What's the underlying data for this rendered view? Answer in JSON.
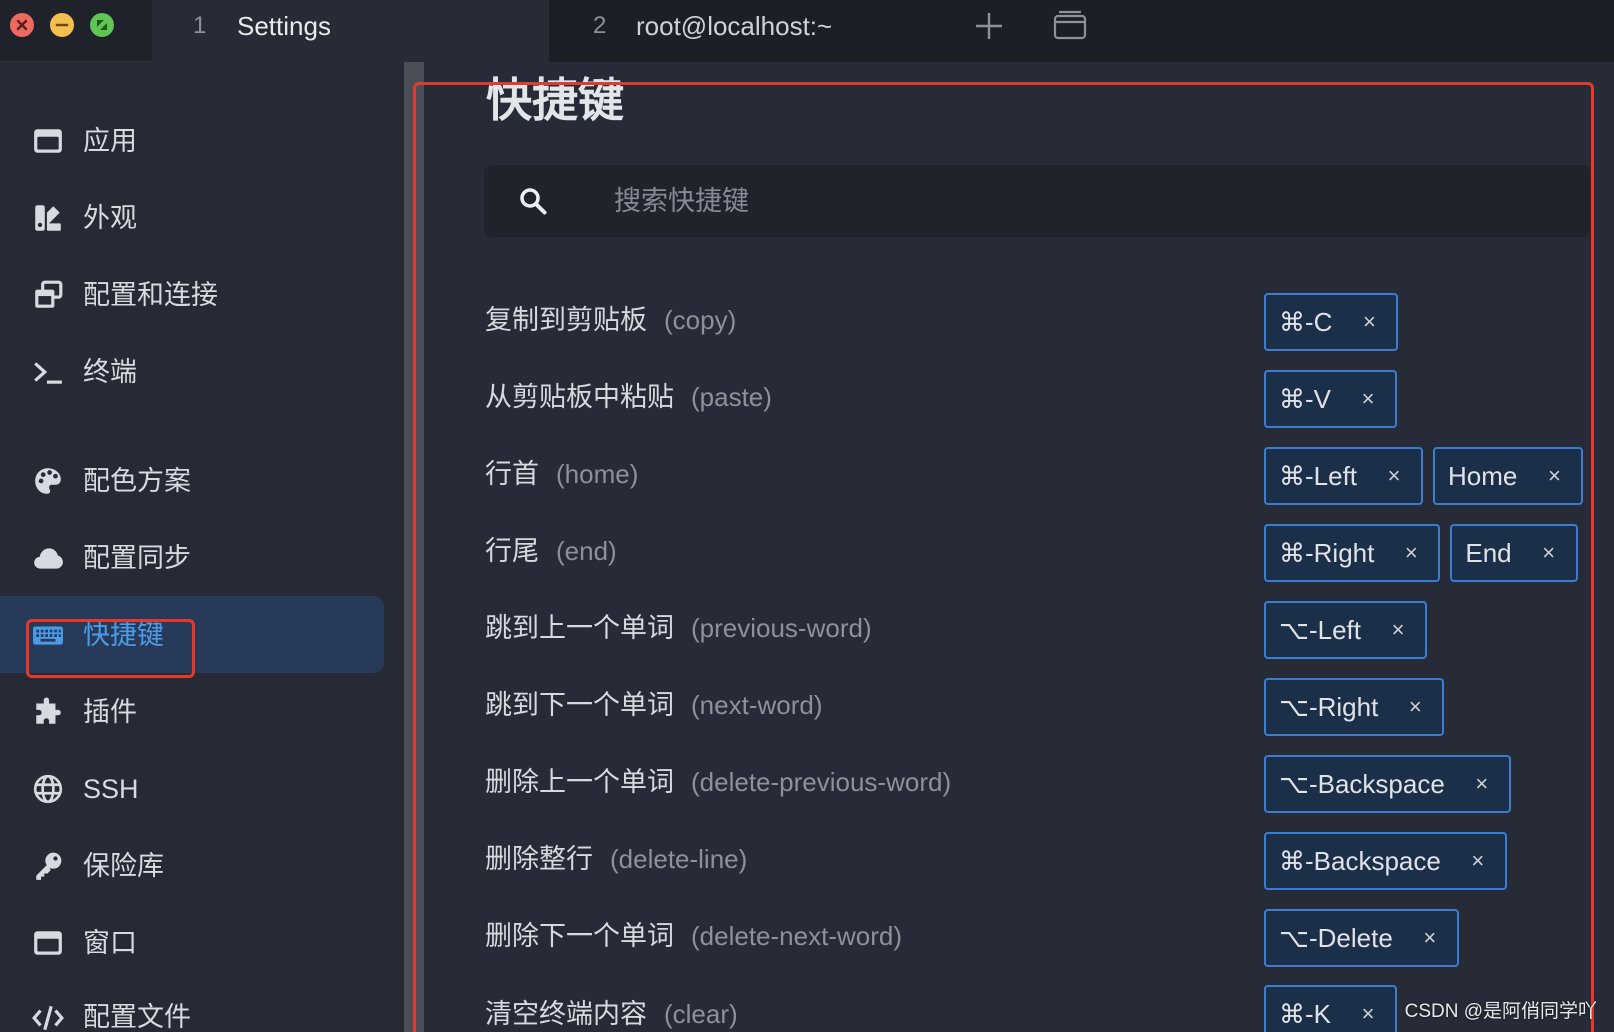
{
  "window": {
    "controls": [
      {
        "action": "close",
        "icon": "close-icon",
        "color": "#ed6a5e"
      },
      {
        "action": "minimize",
        "icon": "minimize-icon",
        "color": "#f5bf4f"
      },
      {
        "action": "maximize",
        "icon": "maximize-icon",
        "color": "#61c554"
      }
    ],
    "tabs": [
      {
        "number": "1",
        "title": "Settings",
        "active": true
      },
      {
        "number": "2",
        "title": "root@localhost:~",
        "active": false
      }
    ],
    "new_tab_icon": "plus-icon",
    "tabs_overview_icon": "window-stack-icon"
  },
  "sidebar": {
    "items": [
      {
        "label": "应用",
        "icon": "app-window-icon"
      },
      {
        "label": "外观",
        "icon": "swatchbook-icon"
      },
      {
        "label": "配置和连接",
        "icon": "window-restore-icon"
      },
      {
        "label": "终端",
        "icon": "terminal-icon"
      },
      {
        "label": "配色方案",
        "icon": "palette-icon"
      },
      {
        "label": "配置同步",
        "icon": "cloud-icon"
      },
      {
        "label": "快捷键",
        "icon": "keyboard-icon",
        "active": true
      },
      {
        "label": "插件",
        "icon": "puzzle-icon"
      },
      {
        "label": "SSH",
        "icon": "globe-icon"
      },
      {
        "label": "保险库",
        "icon": "key-icon"
      },
      {
        "label": "窗口",
        "icon": "window-icon"
      },
      {
        "label": "配置文件",
        "icon": "code-icon"
      }
    ]
  },
  "main": {
    "heading": "快捷键",
    "search": {
      "placeholder": "搜索快捷键",
      "value": "",
      "icon": "search-icon"
    },
    "remove_key_icon": "remove-hotkey-icon",
    "hotkeys": [
      {
        "name": "复制到剪贴板",
        "id": "(copy)",
        "keys": [
          "⌘-C"
        ]
      },
      {
        "name": "从剪贴板中粘贴",
        "id": "(paste)",
        "keys": [
          "⌘-V"
        ]
      },
      {
        "name": "行首",
        "id": "(home)",
        "keys": [
          "⌘-Left",
          "Home"
        ]
      },
      {
        "name": "行尾",
        "id": "(end)",
        "keys": [
          "⌘-Right",
          "End"
        ]
      },
      {
        "name": "跳到上一个单词",
        "id": "(previous-word)",
        "keys": [
          "⌥-Left"
        ]
      },
      {
        "name": "跳到下一个单词",
        "id": "(next-word)",
        "keys": [
          "⌥-Right"
        ]
      },
      {
        "name": "删除上一个单词",
        "id": "(delete-previous-word)",
        "keys": [
          "⌥-Backspace"
        ]
      },
      {
        "name": "删除整行",
        "id": "(delete-line)",
        "keys": [
          "⌘-Backspace"
        ]
      },
      {
        "name": "删除下一个单词",
        "id": "(delete-next-word)",
        "keys": [
          "⌥-Delete"
        ]
      },
      {
        "name": "清空终端内容",
        "id": "(clear)",
        "keys": [
          "⌘-K"
        ]
      }
    ]
  },
  "watermark": "CSDN @是阿俏同学吖",
  "colors": {
    "accent": "#4b9ce8",
    "chip_border": "#3a7dd1",
    "annotation": "#e23b2e"
  }
}
